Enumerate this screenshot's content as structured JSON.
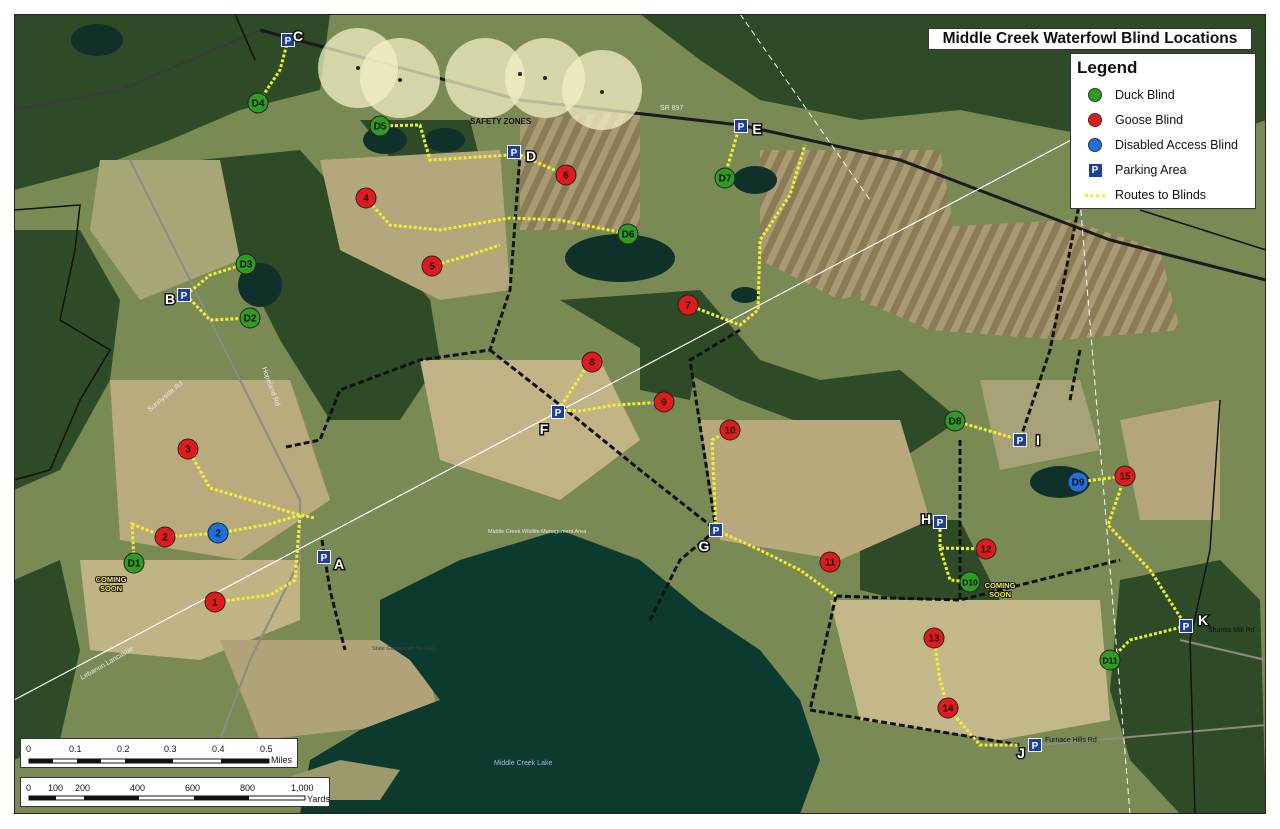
{
  "title": "Middle Creek Waterfowl Blind Locations",
  "legend": {
    "heading": "Legend",
    "items": [
      {
        "label": "Duck Blind",
        "symbol": "duck-blind-icon",
        "color": "#2e9b23"
      },
      {
        "label": "Goose Blind",
        "symbol": "goose-blind-icon",
        "color": "#e11b1b"
      },
      {
        "label": "Disabled Access Blind",
        "symbol": "disabled-access-icon",
        "color": "#1e6fe0"
      },
      {
        "label": "Parking Area",
        "symbol": "parking-icon",
        "color": "#1f3f9a",
        "glyph": "P"
      },
      {
        "label": "Routes to Blinds",
        "symbol": "route-line-icon",
        "color": "#f2ee30"
      }
    ]
  },
  "duck_blinds": [
    "D1",
    "D2",
    "D3",
    "D4",
    "D5",
    "D6",
    "D7",
    "D8",
    "D10",
    "D11"
  ],
  "goose_blinds": [
    "1",
    "2",
    "3",
    "4",
    "5",
    "6",
    "7",
    "8",
    "9",
    "10",
    "11",
    "12",
    "13",
    "14",
    "15"
  ],
  "disabled_blinds": [
    "2",
    "D9"
  ],
  "parking_areas": [
    "A",
    "B",
    "C",
    "D",
    "E",
    "F",
    "G",
    "H",
    "I",
    "J",
    "K"
  ],
  "parking_glyph": "P",
  "coming_soon": [
    "COMING SOON",
    "COMING SOON"
  ],
  "safety_zones_label": "SAFETY ZONES",
  "road_labels": [
    "SR 897",
    "Sunnyside Rd",
    "Hopeland Rd",
    "Lebanon Lancaster",
    "Furnace Hills Rd",
    "Shanks Mill Rd"
  ],
  "place_labels": [
    "Middle Creek Wildlife Management Area",
    "State Gamelands No 046",
    "Middle Creek Lake"
  ],
  "scale_miles": {
    "ticks": [
      "0",
      "0.1",
      "0.2",
      "0.3",
      "0.4",
      "0.5"
    ],
    "unit": "Miles"
  },
  "scale_yards": {
    "ticks": [
      "0",
      "100",
      "200",
      "400",
      "600",
      "800",
      "1,000"
    ],
    "unit": "Yards"
  }
}
